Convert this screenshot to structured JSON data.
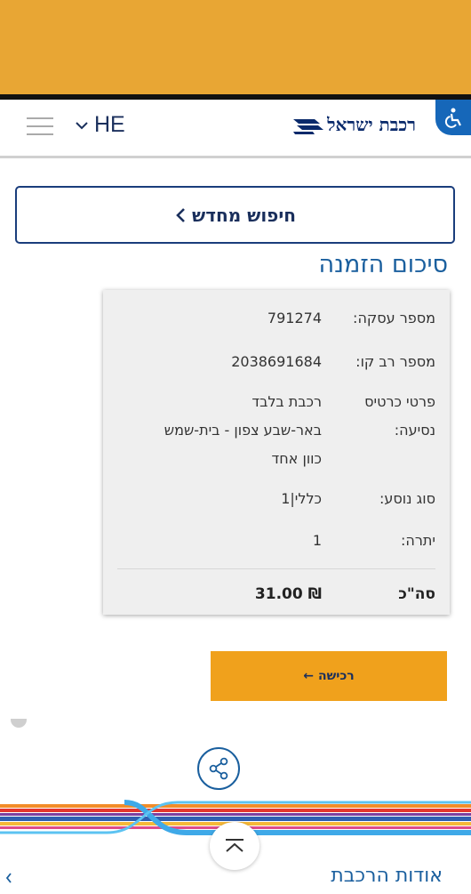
{
  "header": {
    "logo_text": "רכבת ישראל",
    "language": "HE"
  },
  "search_again": {
    "label": "חיפוש מחדש"
  },
  "page_title": "סיכום הזמנה",
  "summary": {
    "transaction_label": "מספר עסקה:",
    "transaction_value": "791274",
    "card_label": "מספר רב קו:",
    "card_value": "2038691684",
    "ticket_label_1": "פרטי כרטיס",
    "ticket_label_2": "נסיעה:",
    "ticket_value_1": "רכבת בלבד",
    "ticket_value_2": "באר-שבע צפון - בית-שמש",
    "ticket_value_3": "כוון אחד",
    "passenger_label": "סוג נוסע:",
    "passenger_value": "כללי|1",
    "balance_label": "יתרה:",
    "balance_value": "1",
    "total_label": "סה\"כ",
    "total_value": "₪ 31.00"
  },
  "buy_button": {
    "label": "רכישה",
    "arrow": "←"
  },
  "footer": {
    "about_label": "אודות הרכבת"
  },
  "colors": {
    "top_band": "#e8a634",
    "navy": "#1a2f5c",
    "accent_blue": "#1a5f9e",
    "buy_orange": "#f0a11c"
  },
  "icons": {
    "hamburger": "menu-icon",
    "accessibility": "accessibility-icon",
    "share": "share-icon",
    "scroll_top": "chevron-up-icon"
  }
}
